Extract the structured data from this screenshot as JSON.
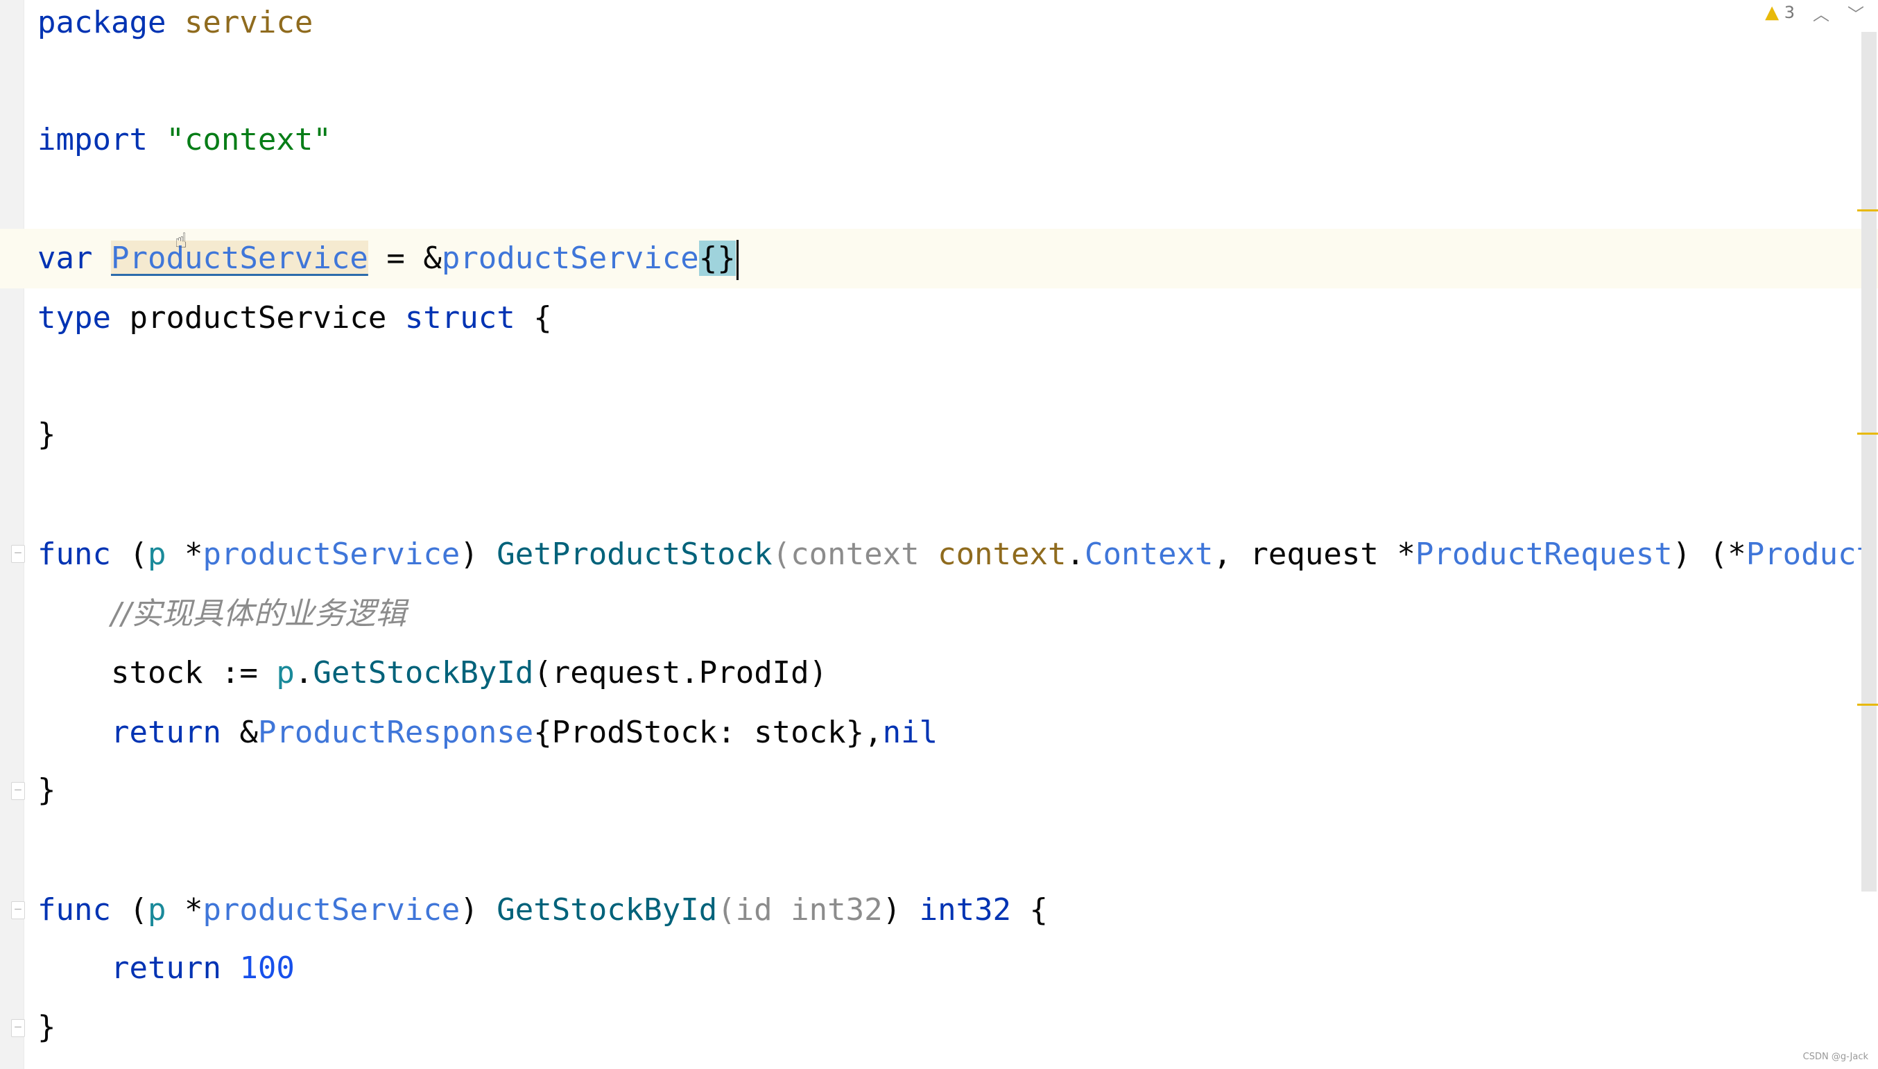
{
  "editor": {
    "language": "go",
    "lines": {
      "package": {
        "kw": "package",
        "name": "service"
      },
      "import": {
        "kw": "import",
        "path": "\"context\""
      },
      "var": {
        "kw": "var",
        "name": "ProductService",
        "op": " = &",
        "type": "productService",
        "brace": "{}"
      },
      "type": {
        "kw": "type",
        "name": " productService ",
        "kw2": "struct",
        "brace": " {"
      },
      "close1": "}",
      "func1": {
        "kw": "func",
        "open": " (",
        "recv": "p",
        "star": " *",
        "recvType": "productService",
        "close": ") ",
        "name": "GetProductStock",
        "p1name": "(context ",
        "p1pkg": "context",
        "dot": ".",
        "p1type": "Context",
        "sep": ", request *",
        "p2type": "ProductRequest",
        "ret": ") (*",
        "retType": "Product"
      },
      "comment": "//实现具体的业务逻辑",
      "stock": {
        "lhs": "stock := ",
        "recv": "p",
        "dot": ".",
        "call": "GetStockById",
        "args": "(request.ProdId)"
      },
      "return1": {
        "kw": "return",
        "amp": " &",
        "type": "ProductResponse",
        "body": "{ProdStock: stock},",
        "nil": "nil"
      },
      "close2": "}",
      "func2": {
        "kw": "func",
        "open": " (",
        "recv": "p",
        "star": " *",
        "recvType": "productService",
        "close": ") ",
        "name": "GetStockById",
        "params": "(id int32",
        "paren": ") ",
        "retType": "int32",
        "brace": " {"
      },
      "return2": {
        "kw": "return",
        "value": " 100"
      },
      "close3": "}"
    }
  },
  "inspection": {
    "warning_icon": "warning-triangle-icon",
    "warning_count": "3",
    "prev_icon": "chevron-up-icon",
    "next_icon": "chevron-down-icon"
  },
  "watermark": "CSDN @g-Jack",
  "colors": {
    "keyword": "#0033b3",
    "string": "#067d17",
    "warning": "#e8b90a",
    "current_line": "#fdfbf0"
  }
}
